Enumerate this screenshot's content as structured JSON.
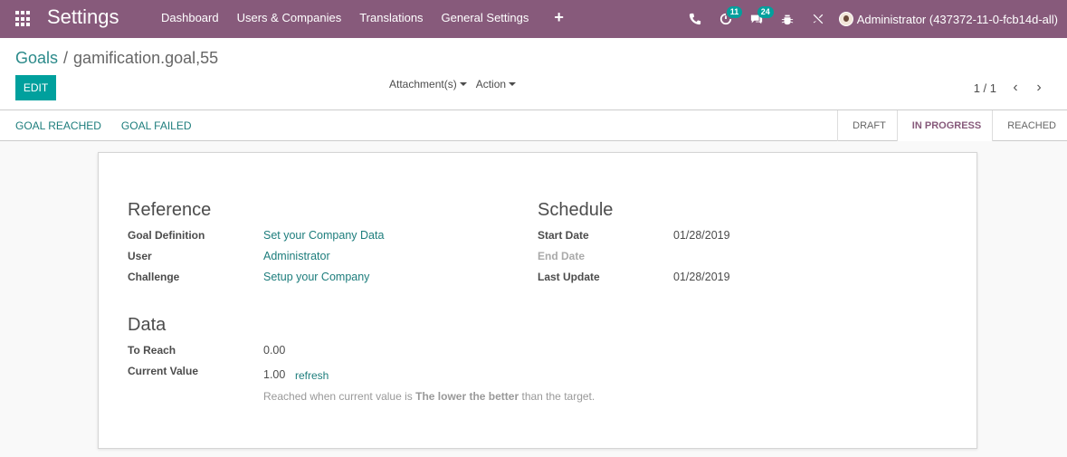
{
  "navbar": {
    "app_title": "Settings",
    "menu": [
      "Dashboard",
      "Users & Companies",
      "Translations",
      "General Settings"
    ],
    "plus": "+",
    "badges": {
      "activities": "11",
      "messages": "24"
    },
    "user": "Administrator (437372-11-0-fcb14d-all)"
  },
  "breadcrumb": {
    "parent": "Goals",
    "separator": "/",
    "current": "gamification.goal,55"
  },
  "buttons": {
    "edit": "EDIT"
  },
  "sidebar": {
    "attachments": "Attachment(s)",
    "action": "Action"
  },
  "pager": {
    "value": "1 / 1",
    "prev": "‹",
    "next": "›"
  },
  "status_buttons": {
    "reached": "GOAL REACHED",
    "failed": "GOAL FAILED"
  },
  "stages": {
    "draft": "DRAFT",
    "in_progress": "IN PROGRESS",
    "reached": "REACHED"
  },
  "reference": {
    "title": "Reference",
    "goal_definition_label": "Goal Definition",
    "goal_definition_value": "Set your Company Data",
    "user_label": "User",
    "user_value": "Administrator",
    "challenge_label": "Challenge",
    "challenge_value": "Setup your Company"
  },
  "schedule": {
    "title": "Schedule",
    "start_label": "Start Date",
    "start_value": "01/28/2019",
    "end_label": "End Date",
    "last_label": "Last Update",
    "last_value": "01/28/2019"
  },
  "data_group": {
    "title": "Data",
    "to_reach_label": "To Reach",
    "to_reach_value": "0.00",
    "current_label": "Current Value",
    "current_value": "1.00",
    "refresh": "refresh",
    "help_prefix": "Reached when current value is",
    "help_bold": "The lower the better",
    "help_suffix": "than the target."
  }
}
